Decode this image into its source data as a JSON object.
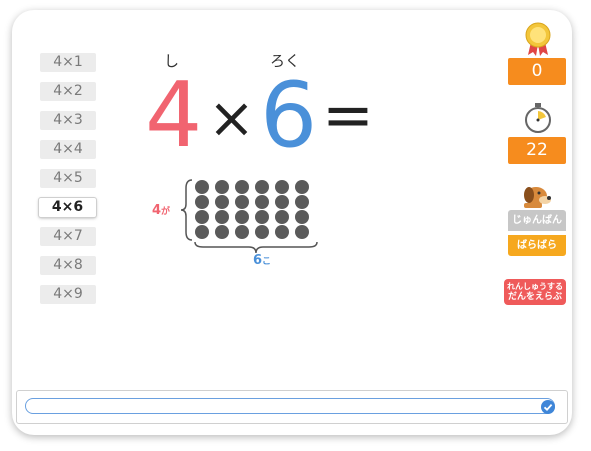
{
  "facts": [
    "4×1",
    "4×2",
    "4×3",
    "4×4",
    "4×5",
    "4×6",
    "4×7",
    "4×8",
    "4×9"
  ],
  "active_fact_index": 5,
  "problem": {
    "reading_a": "し",
    "reading_b": "ろく",
    "a": "4",
    "times": "×",
    "b": "6",
    "equals": "="
  },
  "grid": {
    "rows": 4,
    "cols": 6,
    "row_label_num": "4",
    "row_label_suffix": "が",
    "col_label_num": "6",
    "col_label_suffix": "こ"
  },
  "stats": {
    "medals": "0",
    "timer": "22"
  },
  "modes": {
    "ordered": "じゅんばん",
    "random": "ばらばら"
  },
  "pick_button": {
    "line1": "れんしゅうする",
    "line2": "だんをえらぶ"
  },
  "answer_input": {
    "value": "",
    "placeholder": ""
  },
  "colors": {
    "first_factor": "#f16470",
    "second_factor": "#4a90d9",
    "counter": "#f68c1e",
    "random_mode": "#f6a81e",
    "pick": "#ef5a5a"
  }
}
